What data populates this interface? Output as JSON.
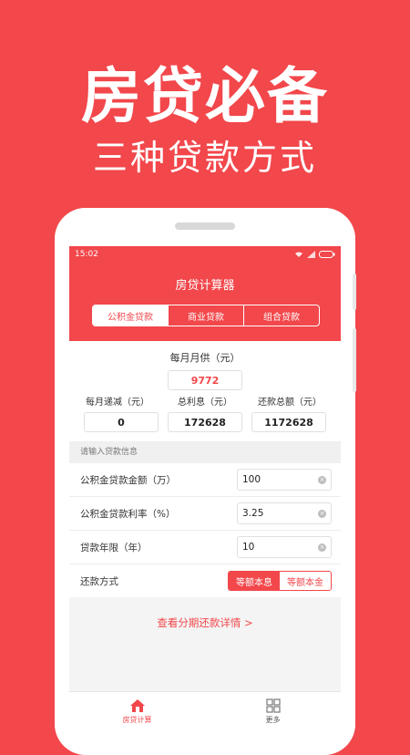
{
  "promo": {
    "title": "房贷必备",
    "subtitle": "三种贷款方式"
  },
  "status_bar": {
    "time": "15:02"
  },
  "app": {
    "title": "房贷计算器",
    "tabs": [
      {
        "label": "公积金贷款",
        "active": true
      },
      {
        "label": "商业贷款",
        "active": false
      },
      {
        "label": "组合贷款",
        "active": false
      }
    ]
  },
  "summary": {
    "monthly_label": "每月月供（元）",
    "monthly_value": "9772",
    "decrease_label": "每月递减（元）",
    "decrease_value": "0",
    "interest_label": "总利息（元）",
    "interest_value": "172628",
    "total_label": "还款总额（元）",
    "total_value": "1172628"
  },
  "form": {
    "section_label": "请输入贷款信息",
    "amount_label": "公积金贷款金额（万）",
    "amount_value": "100",
    "rate_label": "公积金贷款利率（%）",
    "rate_value": "3.25",
    "years_label": "贷款年限（年）",
    "years_value": "10",
    "method_label": "还款方式",
    "method_options": [
      "等额本息",
      "等额本金"
    ],
    "method_selected": "等额本息"
  },
  "detail_link": "查看分期还款详情 >",
  "bottom_nav": [
    {
      "label": "房贷计算",
      "icon": "home-icon",
      "active": true
    },
    {
      "label": "更多",
      "icon": "grid-icon",
      "active": false
    }
  ],
  "colors": {
    "accent": "#f2474b"
  }
}
